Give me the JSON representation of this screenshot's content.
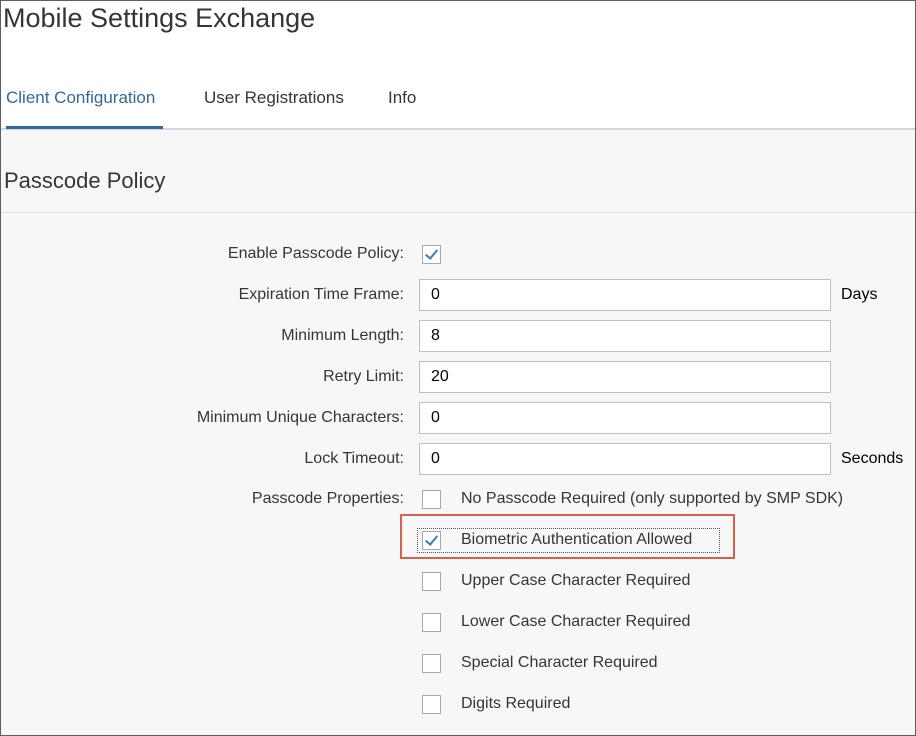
{
  "app": {
    "title": "Mobile Settings Exchange"
  },
  "tabs": [
    {
      "label": "Client Configuration",
      "selected": true
    },
    {
      "label": "User Registrations",
      "selected": false
    },
    {
      "label": "Info",
      "selected": false
    }
  ],
  "section": {
    "title": "Passcode Policy"
  },
  "form": {
    "enable_policy": {
      "label": "Enable Passcode Policy:",
      "checked": true
    },
    "expiration": {
      "label": "Expiration Time Frame:",
      "value": "0",
      "unit": "Days"
    },
    "min_length": {
      "label": "Minimum Length:",
      "value": "8"
    },
    "retry_limit": {
      "label": "Retry Limit:",
      "value": "20"
    },
    "min_unique": {
      "label": "Minimum Unique Characters:",
      "value": "0"
    },
    "lock_timeout": {
      "label": "Lock Timeout:",
      "value": "0",
      "unit": "Seconds"
    },
    "properties_label": "Passcode Properties:",
    "properties": [
      {
        "label": "No Passcode Required (only supported by SMP SDK)",
        "checked": false
      },
      {
        "label": "Biometric Authentication Allowed",
        "checked": true,
        "highlighted": true
      },
      {
        "label": "Upper Case Character Required",
        "checked": false
      },
      {
        "label": "Lower Case Character Required",
        "checked": false
      },
      {
        "label": "Special Character Required",
        "checked": false
      },
      {
        "label": "Digits Required",
        "checked": false
      }
    ]
  },
  "colors": {
    "accent": "#35679d",
    "checkmark": "#427cac",
    "highlight_border": "#d9604a",
    "content_bg": "#f7f7f7"
  }
}
